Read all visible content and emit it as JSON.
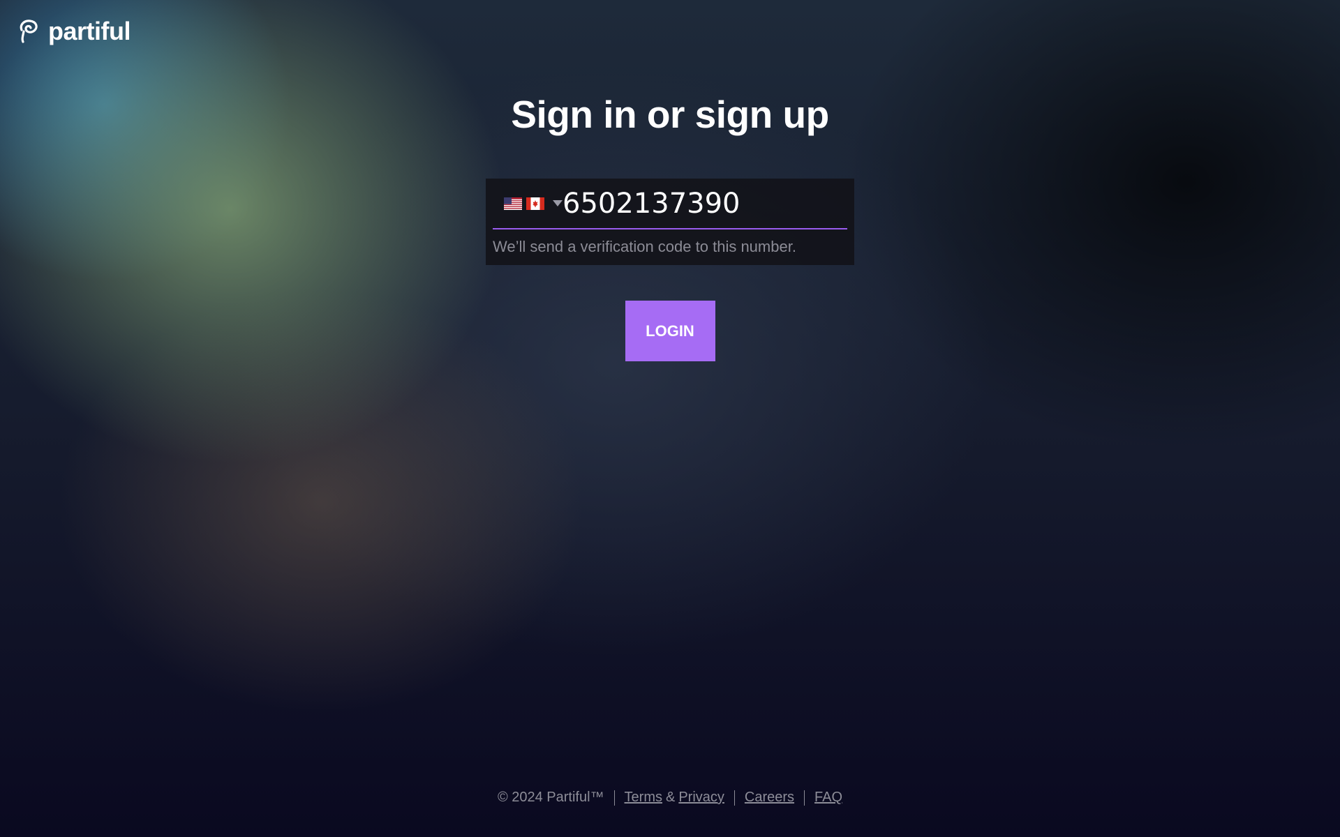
{
  "brand": {
    "name": "partiful",
    "logo_icon": "partiful-logo-icon"
  },
  "main": {
    "title": "Sign in or sign up",
    "phone": {
      "country_flags": [
        "us-flag",
        "ca-flag"
      ],
      "value": "6502137390",
      "valid_icon": "check-icon",
      "helper": "We’ll send a verification code to this number."
    },
    "login_label": "LOGIN"
  },
  "footer": {
    "copyright": "© 2024 Partiful™",
    "links": {
      "terms": "Terms",
      "amp": "&",
      "privacy": "Privacy",
      "careers": "Careers",
      "faq": "FAQ"
    }
  },
  "colors": {
    "accent": "#a66cf4",
    "underline": "#9a5cf0",
    "check": "#a46cf2",
    "muted_text": "#8d8d98"
  }
}
